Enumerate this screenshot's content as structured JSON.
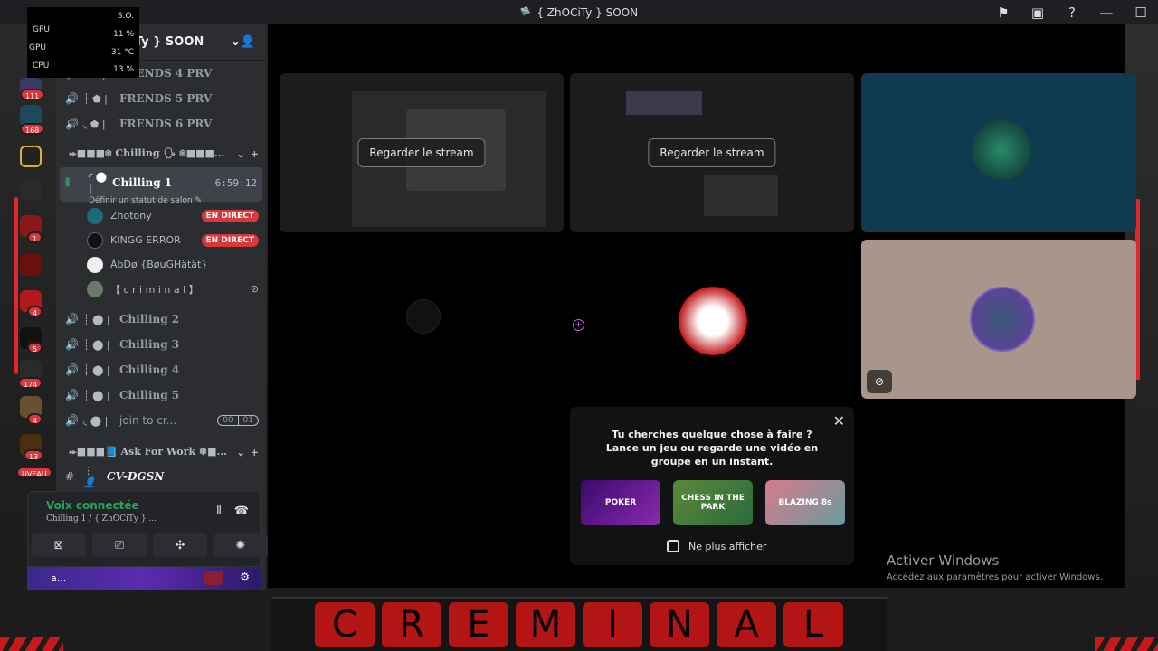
{
  "window": {
    "title": "{ ZhOCiTy } SOON",
    "icons": [
      "flag-icon",
      "inbox-icon",
      "help-icon",
      "minimize-icon",
      "maximize-icon"
    ]
  },
  "overlay": {
    "rows": [
      {
        "label": "S.O.",
        "value": ""
      },
      {
        "label": "GPU",
        "value": "11 %"
      },
      {
        "label": "GPU",
        "value": "31 °C"
      },
      {
        "label": "CPU",
        "value": "13 %"
      }
    ],
    "top_right": "S.O."
  },
  "servers": [
    {
      "badge": "111"
    },
    {
      "badge": "168"
    },
    {
      "badge": ""
    },
    {
      "badge": ""
    },
    {
      "badge": "1"
    },
    {
      "badge": ""
    },
    {
      "badge": "4"
    },
    {
      "badge": "5"
    },
    {
      "badge": "174"
    },
    {
      "badge": "4"
    },
    {
      "badge": "13"
    },
    {
      "badge": "UVEAU"
    }
  ],
  "guild": {
    "name": "{ ZhOCiTy } SOON"
  },
  "channels_top": [
    {
      "name": "FRENDS 4 PRV"
    },
    {
      "name": "FRENDS 5 PRV"
    },
    {
      "name": "FRENDS 6 PRV"
    }
  ],
  "category_chilling": "⬰■■■❄ Chilling 🗣 ❄■■■...",
  "active_channel": {
    "name": "Chilling 1",
    "timer": "6:59:12",
    "status": "Définir un statut de salon"
  },
  "voice_users": [
    {
      "name": "Zhotony",
      "live": "EN DIRECT"
    },
    {
      "name": "KINGG ERROR",
      "live": "EN DIRECT"
    },
    {
      "name": "ÂbDø {BøuGHätät}",
      "live": ""
    },
    {
      "name": "【 c r i m i n a l 】",
      "live": ""
    }
  ],
  "channels_bottom": [
    {
      "name": "Chilling 2"
    },
    {
      "name": "Chilling 3"
    },
    {
      "name": "Chilling 4"
    },
    {
      "name": "Chilling 5"
    },
    {
      "name": "join to cr...",
      "counter": [
        "00",
        "01"
      ]
    }
  ],
  "category_work": "⬰■■■📘 Ask For Work ❄■...",
  "text_channel": "CV-DGSN",
  "voice_panel": {
    "title": "Voix connectée",
    "subtitle": "Chilling 1 / { ZhOCiTy } ..."
  },
  "userbar": {
    "name": "a..."
  },
  "tiles": {
    "watch_label": "Regarder le stream",
    "watch_label_2": "Regarder le stream"
  },
  "popup": {
    "line1": "Tu cherches quelque chose à faire ?",
    "line2": "Lance un jeu ou regarde une vidéo en groupe en un instant.",
    "games": [
      "POKER",
      "CHESS IN THE PARK",
      "BLAZING 8s"
    ],
    "checkbox_label": "Ne plus afficher"
  },
  "watermark": {
    "title": "Activer Windows",
    "subtitle": "Accédez aux paramètres pour activer Windows."
  },
  "banner": {
    "letters": [
      "C",
      "R",
      "E",
      "M",
      "I",
      "N",
      "A",
      "L"
    ]
  },
  "colors": {
    "accent_red": "#da373c",
    "connected_green": "#23a55a",
    "tile_blue": "#0f3a4f",
    "tile_beige": "#a8968a"
  }
}
